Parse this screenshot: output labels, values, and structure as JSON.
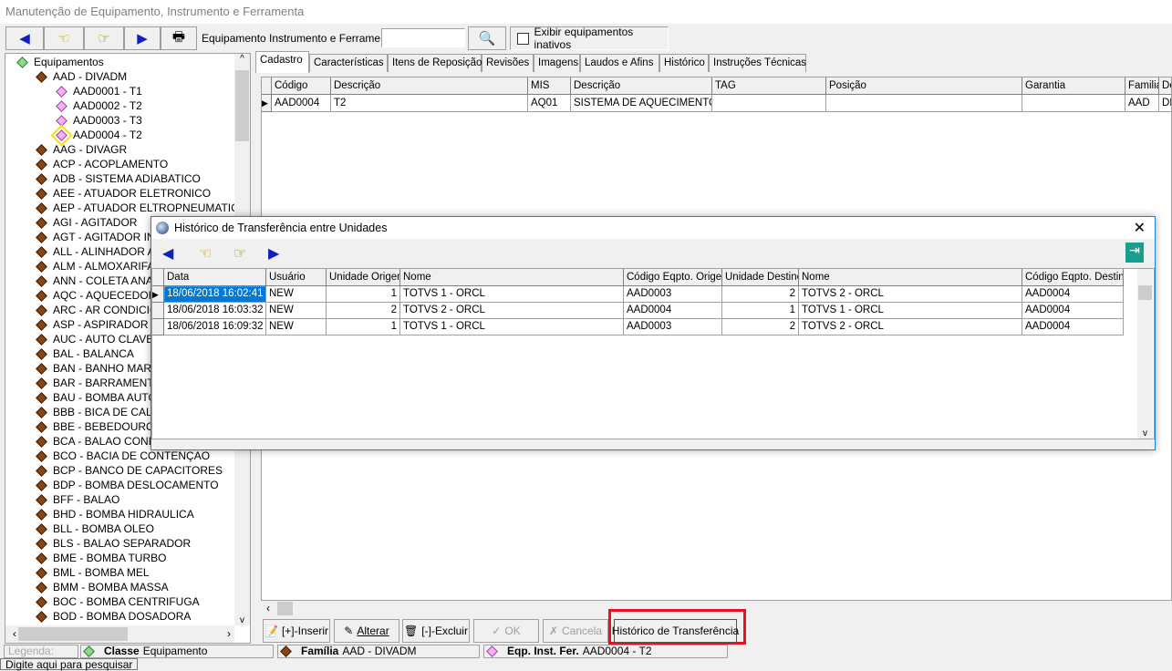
{
  "window": {
    "title": "Manutenção de Equipamento, Instrumento e Ferramenta"
  },
  "toolbar": {
    "search_label": "Equipamento Instrumento e Ferramenta",
    "search_value": "",
    "show_inactive_label": "Exibir equipamentos inativos",
    "show_inactive_checked": false
  },
  "tree": {
    "root": "Equipamentos",
    "items": [
      {
        "label": "AAD - DIVADM",
        "level": 1,
        "type": "family"
      },
      {
        "label": "AAD0001 - T1",
        "level": 2,
        "type": "equipment"
      },
      {
        "label": "AAD0002 - T2",
        "level": 2,
        "type": "equipment"
      },
      {
        "label": "AAD0003 - T3",
        "level": 2,
        "type": "equipment"
      },
      {
        "label": "AAD0004 - T2",
        "level": 2,
        "type": "equipment",
        "selected": true
      },
      {
        "label": "AAG - DIVAGR",
        "level": 1,
        "type": "family"
      },
      {
        "label": "ACP - ACOPLAMENTO",
        "level": 1,
        "type": "family"
      },
      {
        "label": "ADB - SISTEMA ADIABATICO",
        "level": 1,
        "type": "family"
      },
      {
        "label": "AEE - ATUADOR ELETRONICO",
        "level": 1,
        "type": "family"
      },
      {
        "label": "AEP - ATUADOR ELTROPNEUMATICO",
        "level": 1,
        "type": "family"
      },
      {
        "label": "AGI - AGITADOR",
        "level": 1,
        "type": "family"
      },
      {
        "label": "AGT - AGITADOR IN",
        "level": 1,
        "type": "family"
      },
      {
        "label": "ALL - ALINHADOR A",
        "level": 1,
        "type": "family"
      },
      {
        "label": "ALM - ALMOXARIFA",
        "level": 1,
        "type": "family"
      },
      {
        "label": "ANN - COLETA ANA",
        "level": 1,
        "type": "family"
      },
      {
        "label": "AQC - AQUECEDOR",
        "level": 1,
        "type": "family"
      },
      {
        "label": "ARC - AR CONDICIO",
        "level": 1,
        "type": "family"
      },
      {
        "label": "ASP - ASPIRADOR",
        "level": 1,
        "type": "family"
      },
      {
        "label": "AUC - AUTO CLAVE",
        "level": 1,
        "type": "family"
      },
      {
        "label": "BAL - BALANCA",
        "level": 1,
        "type": "family"
      },
      {
        "label": "BAN - BANHO MARI",
        "level": 1,
        "type": "family"
      },
      {
        "label": "BAR - BARRAMENT",
        "level": 1,
        "type": "family"
      },
      {
        "label": "BAU - BOMBA AUTO",
        "level": 1,
        "type": "family"
      },
      {
        "label": "BBB - BICA DE CALD",
        "level": 1,
        "type": "family"
      },
      {
        "label": "BBE - BEBEDOURO",
        "level": 1,
        "type": "family"
      },
      {
        "label": "BCA - BALAO COND",
        "level": 1,
        "type": "family"
      },
      {
        "label": "BCO - BACIA DE CONTENÇAO",
        "level": 1,
        "type": "family"
      },
      {
        "label": "BCP - BANCO DE CAPACITORES",
        "level": 1,
        "type": "family"
      },
      {
        "label": "BDP - BOMBA DESLOCAMENTO",
        "level": 1,
        "type": "family"
      },
      {
        "label": "BFF - BALAO",
        "level": 1,
        "type": "family"
      },
      {
        "label": "BHD - BOMBA HIDRAULICA",
        "level": 1,
        "type": "family"
      },
      {
        "label": "BLL - BOMBA OLEO",
        "level": 1,
        "type": "family"
      },
      {
        "label": "BLS - BALAO SEPARADOR",
        "level": 1,
        "type": "family"
      },
      {
        "label": "BME - BOMBA TURBO",
        "level": 1,
        "type": "family"
      },
      {
        "label": "BML - BOMBA MEL",
        "level": 1,
        "type": "family"
      },
      {
        "label": "BMM - BOMBA MASSA",
        "level": 1,
        "type": "family"
      },
      {
        "label": "BOC - BOMBA CENTRIFUGA",
        "level": 1,
        "type": "family"
      },
      {
        "label": "BOD - BOMBA DOSADORA",
        "level": 1,
        "type": "family"
      }
    ]
  },
  "tabs": [
    "Cadastro",
    "Características",
    "Itens de Reposição",
    "Revisões",
    "Imagens",
    "Laudos e Afins",
    "Histórico",
    "Instruções Técnicas"
  ],
  "main_grid": {
    "columns": [
      "Código",
      "Descrição",
      "MIS",
      "Descrição",
      "TAG",
      "Posição",
      "Garantia",
      "Familia",
      "De"
    ],
    "rows": [
      [
        "AAD0004",
        "T2",
        "AQ01",
        "SISTEMA DE AQUECIMENTO",
        "",
        "",
        "",
        "AAD",
        "DIV"
      ]
    ]
  },
  "buttons": {
    "insert": "[+]-Inserir",
    "edit": "Alterar",
    "delete": "[-]-Excluir",
    "ok": "OK",
    "cancel": "Cancela",
    "transfer_history": "Histórico de Transferência"
  },
  "status": {
    "legend": "Legenda:",
    "class_label": "Classe",
    "class_value": "Equipamento",
    "family_label": "Família",
    "family_value": "AAD - DIVADM",
    "eqp_label": "Eqp. Inst. Fer.",
    "eqp_value": "AAD0004 - T2",
    "tooltip": "Digite aqui para pesquisar"
  },
  "dialog": {
    "title": "Histórico de Transferência entre Unidades",
    "columns": [
      "Data",
      "Usuário",
      "Unidade Origem",
      "Nome",
      "Código Eqpto. Origem",
      "Unidade Destino",
      "Nome",
      "Código Eqpto. Destino"
    ],
    "rows": [
      [
        "18/06/2018 16:02:41",
        "NEW",
        "1",
        "TOTVS 1 - ORCL",
        "AAD0003",
        "2",
        "TOTVS 2 - ORCL",
        "AAD0004"
      ],
      [
        "18/06/2018 16:03:32",
        "NEW",
        "2",
        "TOTVS 2 - ORCL",
        "AAD0004",
        "1",
        "TOTVS 1 - ORCL",
        "AAD0004"
      ],
      [
        "18/06/2018 16:09:32",
        "NEW",
        "1",
        "TOTVS 1 - ORCL",
        "AAD0003",
        "2",
        "TOTVS 2 - ORCL",
        "AAD0004"
      ]
    ]
  },
  "colors": {
    "selection": "#0078d7",
    "highlight_box": "#e81123",
    "dialog_border": "#1883d7",
    "family_icon": "#8b4513",
    "equipment_icon": "#f4b0f4"
  }
}
